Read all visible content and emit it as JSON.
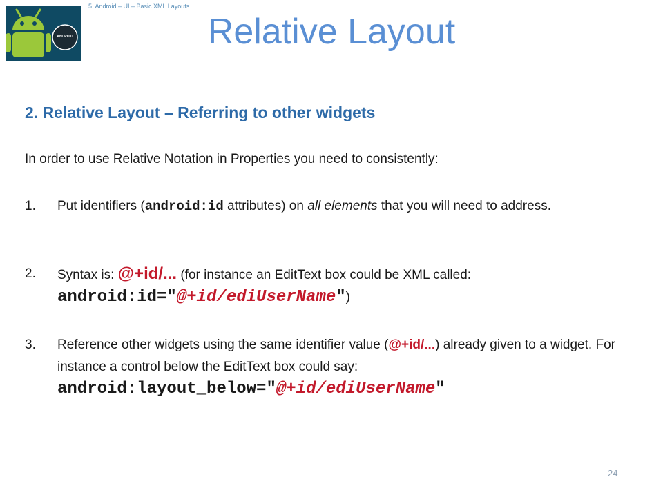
{
  "header": {
    "caption": "5. Android – UI – Basic XML Layouts",
    "logo_icon": "android-robot-icon",
    "logo_text": "ANDROID"
  },
  "title": "Relative Layout",
  "subtitle": "2. Relative Layout – Referring to other widgets",
  "intro": "In order to use Relative Notation in Properties you need to consistently:",
  "items": [
    {
      "number": "1.",
      "t1": "Put identifiers (",
      "code": "android:id",
      "t2": " attributes) on ",
      "emph": "all elements",
      "t3": " that you will need to address."
    },
    {
      "number": "2.",
      "t1": "Syntax is: ",
      "red": "@+id/...",
      "t2": " (for instance an EditText box could be XML called: ",
      "code_attr": "android:id=\"",
      "code_value": "@+id/ediUserName",
      "code_end": "\"",
      "t3": ")"
    },
    {
      "number": "3.",
      "t1": "Reference other widgets using the same identifier value (",
      "red": "@+id/...",
      "t2": ") already given to a widget. For instance a control below the EditText box could say: ",
      "code_attr": "android:layout_below=\"",
      "code_value": "@+id/ediUserName",
      "code_end": "\""
    }
  ],
  "page_number": "24",
  "colors": {
    "title": "#5a8fd4",
    "subtitle": "#2d6aa8",
    "accent_red": "#c3192b",
    "logo_bg": "#0f4a63",
    "android_green": "#9bc83a"
  }
}
